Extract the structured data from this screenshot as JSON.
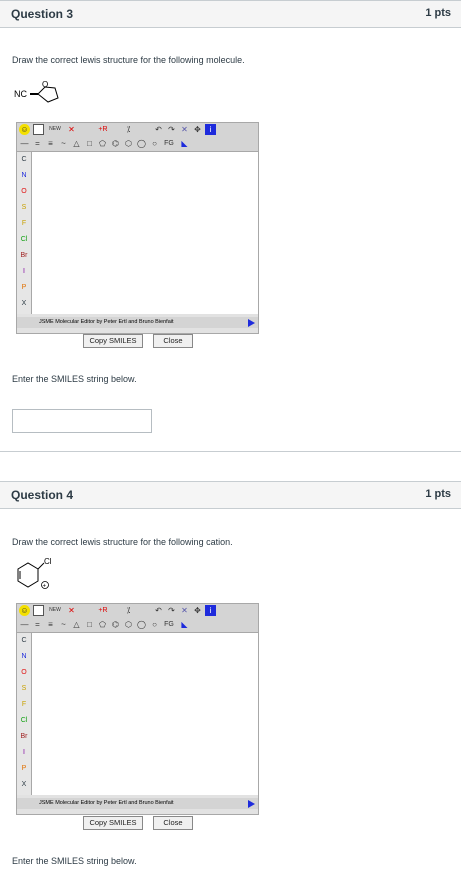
{
  "questions": [
    {
      "title": "Question 3",
      "points": "1 pts",
      "prompt": "Draw the correct lewis structure for the following molecule.",
      "molecule_label": "NC",
      "molecule_atom": "O",
      "smiles_prompt": "Enter the SMILES string below."
    },
    {
      "title": "Question 4",
      "points": "1 pts",
      "prompt": "Draw the correct lewis structure for the following cation.",
      "molecule_label": "Cl",
      "molecule_atom": "+",
      "smiles_prompt": "Enter the SMILES string below."
    }
  ],
  "editor": {
    "new_label": "NEW",
    "r_label": "+R",
    "fg_label": "FG",
    "status_text": "JSME Molecular Editor by Peter Ertl and Bruno Bienfait",
    "copy_label": "Copy SMILES",
    "close_label": "Close",
    "elements": [
      "C",
      "N",
      "O",
      "S",
      "F",
      "Cl",
      "Br",
      "I",
      "P",
      "X"
    ],
    "element_colors": [
      "#000000",
      "#1e2bdc",
      "#e01010",
      "#c8a000",
      "#c8a000",
      "#10a010",
      "#a02020",
      "#8000a0",
      "#e07000",
      "#000000"
    ]
  }
}
